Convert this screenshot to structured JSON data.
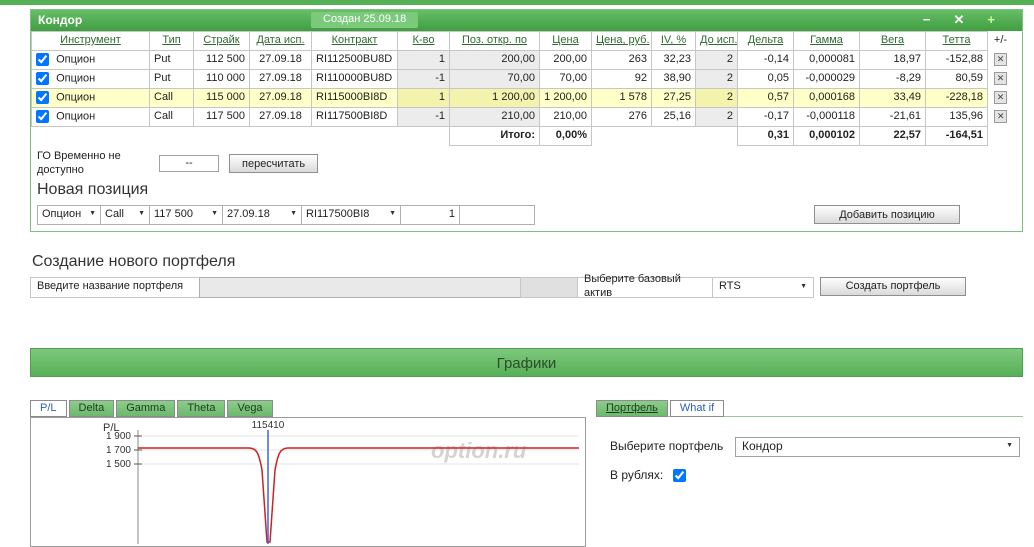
{
  "window": {
    "title": "Кондор",
    "created": "Создан 25.09.18",
    "controls": {
      "minimize": "−",
      "close": "✕",
      "add": "+"
    }
  },
  "icons": {
    "dropdown_arrow": "▼",
    "delete": "✕"
  },
  "colors": {
    "accent_green": "#4da64d",
    "highlight_row": "#ffffc8",
    "chart_line_red": "#cc2222",
    "price_marker_blue": "#4466cc",
    "tab_green": "#7cc47c"
  },
  "positions_table": {
    "headers": [
      "Инструмент",
      "Тип",
      "Страйк",
      "Дата исп.",
      "Контракт",
      "К-во",
      "Поз. откр. по",
      "Цена",
      "Цена, руб.",
      "IV, %",
      "До исп.",
      "Дельта",
      "Гамма",
      "Вега",
      "Тетта",
      "+/-"
    ],
    "rows": [
      {
        "checked": true,
        "instrument": "Опцион",
        "type": "Put",
        "strike": "112 500",
        "exp_date": "27.09.18",
        "contract": "RI112500BU8D",
        "qty": "1",
        "open_pos": "200,00",
        "price": "200,00",
        "price_rub": "263",
        "iv": "32,23",
        "days": "2",
        "delta": "-0,14",
        "gamma": "0,000081",
        "vega": "18,97",
        "theta": "-152,88"
      },
      {
        "checked": true,
        "instrument": "Опцион",
        "type": "Put",
        "strike": "110 000",
        "exp_date": "27.09.18",
        "contract": "RI110000BU8D",
        "qty": "-1",
        "open_pos": "70,00",
        "price": "70,00",
        "price_rub": "92",
        "iv": "38,90",
        "days": "2",
        "delta": "0,05",
        "gamma": "-0,000029",
        "vega": "-8,29",
        "theta": "80,59"
      },
      {
        "checked": true,
        "highlighted": true,
        "instrument": "Опцион",
        "type": "Call",
        "strike": "115 000",
        "exp_date": "27.09.18",
        "contract": "RI115000BI8D",
        "qty": "1",
        "open_pos": "1 200,00",
        "price": "1 200,00",
        "price_rub": "1 578",
        "iv": "27,25",
        "days": "2",
        "delta": "0,57",
        "gamma": "0,000168",
        "vega": "33,49",
        "theta": "-228,18"
      },
      {
        "checked": true,
        "instrument": "Опцион",
        "type": "Call",
        "strike": "117 500",
        "exp_date": "27.09.18",
        "contract": "RI117500BI8D",
        "qty": "-1",
        "open_pos": "210,00",
        "price": "210,00",
        "price_rub": "276",
        "iv": "25,16",
        "days": "2",
        "delta": "-0,17",
        "gamma": "-0,000118",
        "vega": "-21,61",
        "theta": "135,96"
      }
    ],
    "totals": {
      "label": "Итого:",
      "price_pct": "0,00%",
      "delta": "0,31",
      "gamma": "0,000102",
      "vega": "22,57",
      "theta": "-164,51"
    }
  },
  "go": {
    "label": "ГО Временно не доступно",
    "value": "--",
    "recalc_button": "пересчитать"
  },
  "new_position": {
    "title": "Новая позиция",
    "instrument": "Опцион",
    "option_type": "Call",
    "strike": "117 500",
    "exp_date": "27.09.18",
    "contract": "RI117500BI8",
    "qty": "1",
    "add_button": "Добавить позицию"
  },
  "create_portfolio": {
    "title": "Создание нового портфеля",
    "name_label": "Введите название портфеля",
    "name_value": "",
    "asset_label": "Выберите базовый актив",
    "asset_value": "RTS",
    "create_button": "Создать портфель"
  },
  "charts_section": {
    "title": "Графики",
    "tabs": [
      "P/L",
      "Delta",
      "Gamma",
      "Theta",
      "Vega"
    ],
    "active_tab": "P/L"
  },
  "chart_data": {
    "type": "line",
    "ylabel": "P/L",
    "ytick_labels": [
      "1 900",
      "1 700",
      "1 500"
    ],
    "price_marker_label": "115410",
    "watermark": "option.ru",
    "line_color": "#cc2222",
    "marker_color": "#4466cc"
  },
  "portfolio_panel": {
    "tabs": [
      "Портфель",
      "What if"
    ],
    "active_tab": "Портфель",
    "select_label": "Выберите портфель",
    "selected_portfolio": "Кондор",
    "rubles_label": "В рублях:",
    "rubles_checked": true
  }
}
